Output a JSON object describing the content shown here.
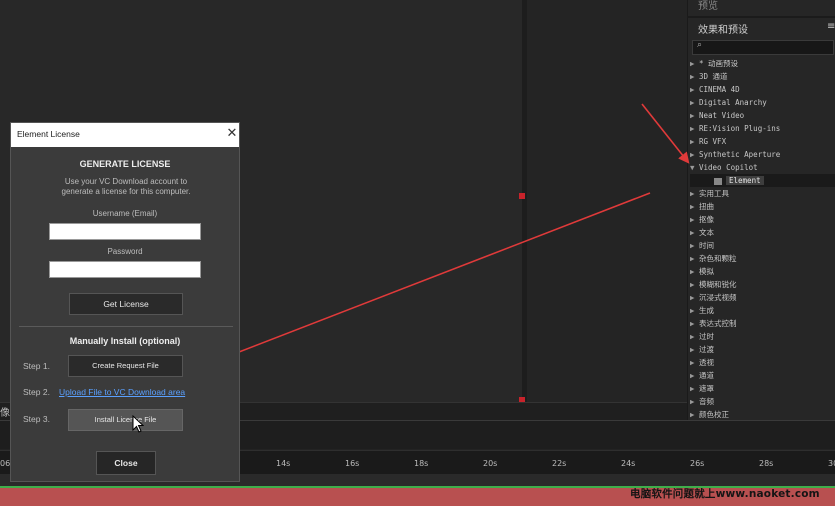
{
  "panel": {
    "preview_title": "预览",
    "effects_title": "效果和预设",
    "menu_glyph": "≡",
    "search_placeholder": "",
    "search_icon": "search-icon",
    "tree": [
      {
        "label": "* 动画预设",
        "expanded": false
      },
      {
        "label": "3D 通道",
        "expanded": false
      },
      {
        "label": "CINEMA 4D",
        "expanded": false
      },
      {
        "label": "Digital Anarchy",
        "expanded": false
      },
      {
        "label": "Neat Video",
        "expanded": false
      },
      {
        "label": "RE:Vision Plug-ins",
        "expanded": false
      },
      {
        "label": "RG VFX",
        "expanded": false
      },
      {
        "label": "Synthetic Aperture",
        "expanded": false
      },
      {
        "label": "Video Copilot",
        "expanded": true
      },
      {
        "label": "Element",
        "child": true
      },
      {
        "label": "实用工具",
        "expanded": false
      },
      {
        "label": "扭曲",
        "expanded": false
      },
      {
        "label": "抠像",
        "expanded": false
      },
      {
        "label": "文本",
        "expanded": false
      },
      {
        "label": "时间",
        "expanded": false
      },
      {
        "label": "杂色和颗粒",
        "expanded": false
      },
      {
        "label": "模拟",
        "expanded": false
      },
      {
        "label": "模糊和锐化",
        "expanded": false
      },
      {
        "label": "沉浸式视频",
        "expanded": false
      },
      {
        "label": "生成",
        "expanded": false
      },
      {
        "label": "表达式控制",
        "expanded": false
      },
      {
        "label": "过时",
        "expanded": false
      },
      {
        "label": "过渡",
        "expanded": false
      },
      {
        "label": "透视",
        "expanded": false
      },
      {
        "label": "通道",
        "expanded": false
      },
      {
        "label": "遮罩",
        "expanded": false
      },
      {
        "label": "音频",
        "expanded": false
      },
      {
        "label": "颜色校正",
        "expanded": false
      }
    ]
  },
  "status_char": "像",
  "timeline": {
    "ticks": [
      "06",
      "14s",
      "16s",
      "18s",
      "20s",
      "22s",
      "24s",
      "26s",
      "28s",
      "30"
    ]
  },
  "watermark": "电脑软件问题就上www.naoket.com",
  "dialog": {
    "title": "Element License",
    "close_glyph": "✕",
    "generate_title": "GENERATE LICENSE",
    "generate_desc": "Use your VC Download account to generate a license for this computer.",
    "username_label": "Username (Email)",
    "username_value": "",
    "password_label": "Password",
    "password_value": "",
    "get_license_label": "Get License",
    "manual_title": "Manually Install (optional)",
    "step1_label": "Step 1.",
    "step1_button": "Create Request File",
    "step2_label": "Step 2.",
    "step2_link": "Upload File to VC Download area",
    "step3_label": "Step 3.",
    "step3_button": "Install License File",
    "close_label": "Close"
  },
  "colors": {
    "annotation_arrow": "#e03a3a",
    "link": "#5aa0ff",
    "timeline_red": "#b85050",
    "timeline_green": "#3fae4b"
  }
}
